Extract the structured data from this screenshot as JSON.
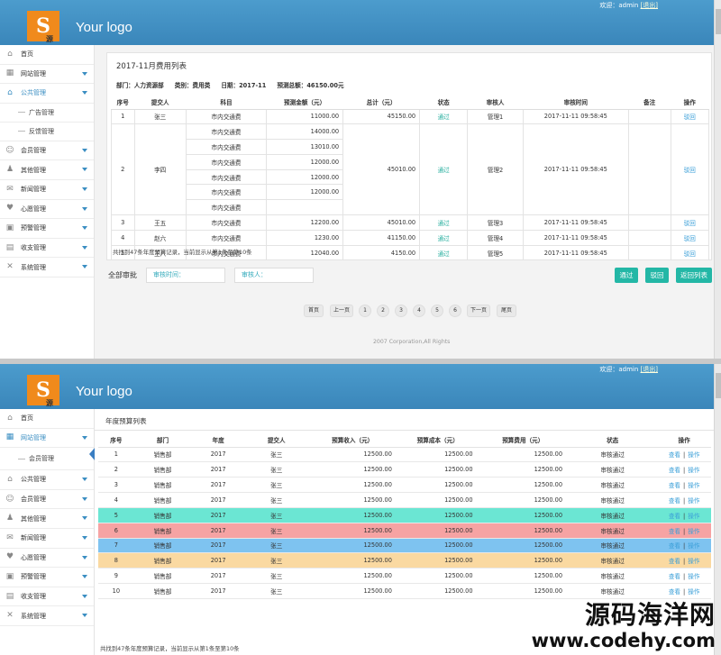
{
  "brand": {
    "logo_text": "Your logo",
    "logo_letter": "S",
    "logo_mark": "源"
  },
  "header": {
    "welcome": "欢迎：admin",
    "logout": "[退出]"
  },
  "colors": {
    "header": "#3b8ec2",
    "accent": "#23b7a6",
    "link": "#3a9fd8",
    "row_teal": "#6be6d3",
    "row_red": "#f6a3a3",
    "row_blue": "#7ec3f0",
    "row_orange": "#fad9a1"
  },
  "sidebar1": {
    "items": [
      {
        "label": "首页",
        "icon": "home-icon"
      },
      {
        "label": "网站管理",
        "icon": "grid-icon"
      },
      {
        "label": "公共管理",
        "icon": "home-icon"
      }
    ],
    "subs": [
      "广告管理",
      "反馈管理"
    ],
    "items2": [
      {
        "label": "会员管理",
        "icon": "users-icon"
      },
      {
        "label": "其他管理",
        "icon": "user-icon"
      },
      {
        "label": "新闻管理",
        "icon": "chat-icon"
      },
      {
        "label": "心愿管理",
        "icon": "heart-icon"
      },
      {
        "label": "预警管理",
        "icon": "folder-icon"
      },
      {
        "label": "收支管理",
        "icon": "chart-icon"
      },
      {
        "label": "系统管理",
        "icon": "tools-icon"
      }
    ]
  },
  "panel1": {
    "title": "2017-11月费用列表",
    "meta": [
      "部门：人力资源部",
      "类别：费用类",
      "日期：2017-11",
      "预测总额：46150.00元"
    ],
    "columns": [
      "序号",
      "提交人",
      "科目",
      "预测金额（元）",
      "总计（元）",
      "状态",
      "审核人",
      "审核时间",
      "备注",
      "操作"
    ],
    "rows": [
      {
        "no": "1",
        "who": "张三",
        "subj": [
          "市内交通费"
        ],
        "amt": [
          "11000.00"
        ],
        "total": "45150.00",
        "status": "通过",
        "rev": "管理1",
        "time": "2017-11-11 09:58:45",
        "note": "",
        "op": "驳回"
      },
      {
        "no": "2",
        "who": "李四",
        "subj": [
          "市内交通费",
          "市内交通费",
          "市内交通费",
          "市内交通费",
          "市内交通费",
          "市内交通费"
        ],
        "amt": [
          "14000.00",
          "13010.00",
          "12000.00",
          "12000.00",
          "12000.00"
        ],
        "total": "45010.00",
        "status": "通过",
        "rev": "管理2",
        "time": "2017-11-11 09:58:45",
        "note": "",
        "op": "驳回"
      },
      {
        "no": "3",
        "who": "王五",
        "subj": [
          "市内交通费"
        ],
        "amt": [
          "12200.00"
        ],
        "total": "45010.00",
        "status": "通过",
        "rev": "管理3",
        "time": "2017-11-11 09:58:45",
        "note": "",
        "op": "驳回"
      },
      {
        "no": "4",
        "who": "赵六",
        "subj": [
          "市内交通费"
        ],
        "amt": [
          "1230.00"
        ],
        "total": "41150.00",
        "status": "通过",
        "rev": "管理4",
        "time": "2017-11-11 09:58:45",
        "note": "",
        "op": "驳回"
      },
      {
        "no": "5",
        "who": "王八",
        "subj": [
          "市内交通费"
        ],
        "amt": [
          "12040.00"
        ],
        "total": "4150.00",
        "status": "通过",
        "rev": "管理5",
        "time": "2017-11-11 09:58:45",
        "note": "",
        "op": "驳回"
      }
    ],
    "footer": "共找到47条年度预算记录，当前显示从第1条至第10条"
  },
  "batch": {
    "label": "全部审批",
    "time_placeholder": "审核时间：",
    "reviewer_placeholder": "审核人：",
    "pass": "通过",
    "reject": "驳回",
    "back": "返回列表"
  },
  "pager": {
    "first": "首页",
    "prev": "上一页",
    "pages": [
      "1",
      "2",
      "3",
      "4",
      "5",
      "6"
    ],
    "next": "下一页",
    "last": "尾页"
  },
  "copyright": "2007 Corporation,All Rights",
  "sidebar2": {
    "top": [
      {
        "label": "首页",
        "icon": "home-icon"
      },
      {
        "label": "网站管理",
        "icon": "grid-icon"
      }
    ],
    "sub": "会员管理",
    "rest": [
      {
        "label": "公共管理",
        "icon": "home-icon"
      },
      {
        "label": "会员管理",
        "icon": "users-icon"
      },
      {
        "label": "其他管理",
        "icon": "user-icon"
      },
      {
        "label": "新闻管理",
        "icon": "chat-icon"
      },
      {
        "label": "心愿管理",
        "icon": "heart-icon"
      },
      {
        "label": "预警管理",
        "icon": "folder-icon"
      },
      {
        "label": "收支管理",
        "icon": "chart-icon"
      },
      {
        "label": "系统管理",
        "icon": "tools-icon"
      }
    ]
  },
  "panel2": {
    "title": "年度预算列表",
    "columns": [
      "序号",
      "部门",
      "年度",
      "提交人",
      "预算收入（元）",
      "预算成本（元）",
      "预算费用（元）",
      "状态",
      "操作"
    ],
    "rows": [
      {
        "no": "1",
        "dept": "销售部",
        "year": "2017",
        "who": "张三",
        "inc": "12500.00",
        "cost": "12500.00",
        "fee": "12500.00",
        "status": "审核通过",
        "hl": ""
      },
      {
        "no": "2",
        "dept": "销售部",
        "year": "2017",
        "who": "张三",
        "inc": "12500.00",
        "cost": "12500.00",
        "fee": "12500.00",
        "status": "审核通过",
        "hl": ""
      },
      {
        "no": "3",
        "dept": "销售部",
        "year": "2017",
        "who": "张三",
        "inc": "12500.00",
        "cost": "12500.00",
        "fee": "12500.00",
        "status": "审核通过",
        "hl": ""
      },
      {
        "no": "4",
        "dept": "销售部",
        "year": "2017",
        "who": "张三",
        "inc": "12500.00",
        "cost": "12500.00",
        "fee": "12500.00",
        "status": "审核通过",
        "hl": ""
      },
      {
        "no": "5",
        "dept": "销售部",
        "year": "2017",
        "who": "张三",
        "inc": "12500.00",
        "cost": "12500.00",
        "fee": "12500.00",
        "status": "审核通过",
        "hl": "#6be6d3"
      },
      {
        "no": "6",
        "dept": "销售部",
        "year": "2017",
        "who": "张三",
        "inc": "12500.00",
        "cost": "12500.00",
        "fee": "12500.00",
        "status": "审核通过",
        "hl": "#f6a3a3"
      },
      {
        "no": "7",
        "dept": "销售部",
        "year": "2017",
        "who": "张三",
        "inc": "12500.00",
        "cost": "12500.00",
        "fee": "12500.00",
        "status": "审核通过",
        "hl": "#7ec3f0"
      },
      {
        "no": "8",
        "dept": "销售部",
        "year": "2017",
        "who": "张三",
        "inc": "12500.00",
        "cost": "12500.00",
        "fee": "12500.00",
        "status": "审核通过",
        "hl": "#fad9a1"
      },
      {
        "no": "9",
        "dept": "销售部",
        "year": "2017",
        "who": "张三",
        "inc": "12500.00",
        "cost": "12500.00",
        "fee": "12500.00",
        "status": "审核通过",
        "hl": ""
      },
      {
        "no": "10",
        "dept": "销售部",
        "year": "2017",
        "who": "张三",
        "inc": "12500.00",
        "cost": "12500.00",
        "fee": "12500.00",
        "status": "审核通过",
        "hl": ""
      }
    ],
    "op_view": "查看",
    "op_sep": "|",
    "op_act": "操作",
    "footer": "共找到47条年度预算记录，当前显示从第1条至第10条"
  },
  "watermark": {
    "line1": "源码海洋网",
    "line2": "www.codehy.com"
  }
}
